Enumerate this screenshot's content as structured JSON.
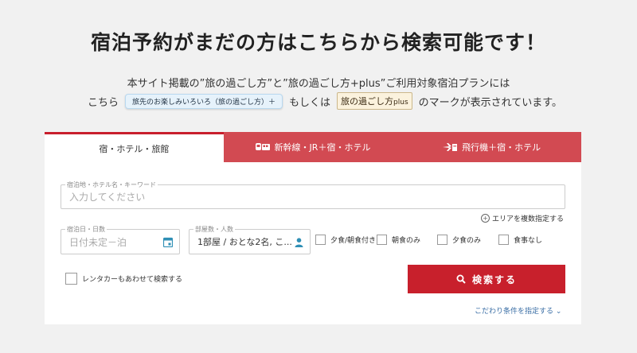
{
  "heading": "宿泊予約がまだの方はこちらから検索可能です！",
  "desc_line1": "本サイト掲載の”旅の過ごし方”と”旅の過ごし方+plus”ご利用対象宿泊プランには",
  "desc_line2": {
    "prefix": "こちら",
    "badge1": "旅先のお楽しみいろいろ（旅の過ごし方）＋",
    "middle": "もしくは",
    "badge2_main": "旅の過ごし方",
    "badge2_plus": "plus",
    "suffix": "のマークが表示されています。"
  },
  "tabs": [
    {
      "label": "宿・ホテル・旅館",
      "active": true
    },
    {
      "label": "新幹線・JR＋宿・ホテル",
      "icon": "train-bus-icon",
      "active": false
    },
    {
      "label": "飛行機＋宿・ホテル",
      "icon": "plane-hotel-icon",
      "active": false
    }
  ],
  "form": {
    "keyword": {
      "label": "宿泊地・ホテル名・キーワード",
      "placeholder": "入力してください"
    },
    "area_link": "エリアを複数指定する",
    "date": {
      "label": "宿泊日・日数",
      "value": "日付未定－泊"
    },
    "rooms": {
      "label": "部屋数・人数",
      "value": "1部屋 / おとな2名, こ..."
    },
    "meals": [
      "夕食/朝食付き",
      "朝食のみ",
      "夕食のみ",
      "食事なし"
    ],
    "rental_car": "レンタカーもあわせて検索する",
    "search_button": "検索する",
    "conditions_link": "こだわり条件を指定する ⌄"
  },
  "colors": {
    "accent": "#c8202c",
    "tab_inactive": "#d24a52",
    "link": "#3a6ea5"
  }
}
